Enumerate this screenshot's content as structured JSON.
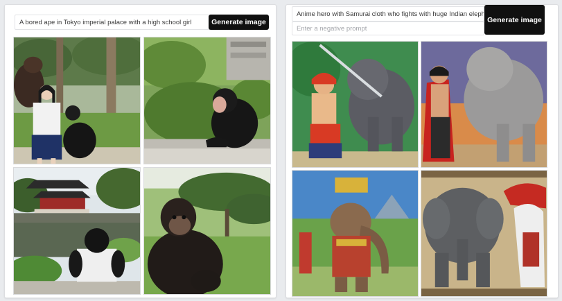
{
  "left_panel": {
    "prompt": "A bored ape in Tokyo imperial palace with a high school girl",
    "generate_label": "Generate image",
    "images": [
      {
        "scene": "ape-standing-beside-schoolgirl"
      },
      {
        "scene": "chimpanzee-sitting-on-wall-with-pine-trees"
      },
      {
        "scene": "ape-seated-facing-japanese-palace-pond"
      },
      {
        "scene": "gorilla-sitting-in-japanese-garden"
      }
    ]
  },
  "right_panel": {
    "prompt": "Anime hero with Samurai cloth who fights with huge Indian elephant",
    "negative_prompt_placeholder": "Enter a negative prompt",
    "generate_label": "Generate image",
    "images": [
      {
        "scene": "anime-samurai-with-sword-beside-elephant"
      },
      {
        "scene": "anime-hero-in-red-cape-with-elephant"
      },
      {
        "scene": "ornate-elephant-headed-warrior"
      },
      {
        "scene": "elephant-facing-white-haired-warrior"
      }
    ]
  },
  "colors": {
    "button_bg": "#101010",
    "button_text": "#ffffff",
    "page_bg": "#e9ebee"
  }
}
